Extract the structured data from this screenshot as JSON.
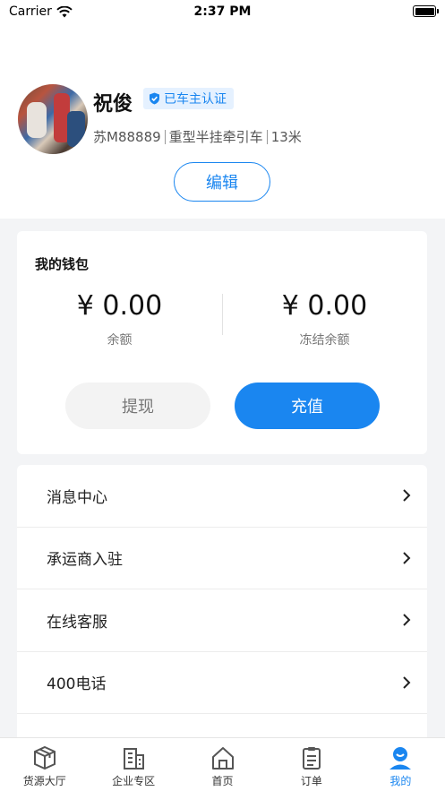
{
  "status_bar": {
    "carrier": "Carrier",
    "time": "2:37 PM"
  },
  "profile": {
    "name": "祝俊",
    "badge": "已车主认证",
    "plate": "苏M88889",
    "vehicle_type": "重型半挂牵引车",
    "length": "13米",
    "edit_label": "编辑"
  },
  "wallet": {
    "title": "我的钱包",
    "balance": "¥ 0.00",
    "balance_label": "余额",
    "frozen": "¥ 0.00",
    "frozen_label": "冻结余额",
    "withdraw_label": "提现",
    "recharge_label": "充值"
  },
  "menu": {
    "items": [
      {
        "label": "消息中心"
      },
      {
        "label": "承运商入驻"
      },
      {
        "label": "在线客服"
      },
      {
        "label": "400电话"
      }
    ]
  },
  "tabbar": {
    "tabs": [
      {
        "label": "货源大厅",
        "icon": "box-icon"
      },
      {
        "label": "企业专区",
        "icon": "building-icon"
      },
      {
        "label": "首页",
        "icon": "home-icon"
      },
      {
        "label": "订单",
        "icon": "clipboard-icon"
      },
      {
        "label": "我的",
        "icon": "user-icon"
      }
    ],
    "active": "我的"
  },
  "colors": {
    "accent": "#1a86f0",
    "background": "#f3f4f6"
  }
}
